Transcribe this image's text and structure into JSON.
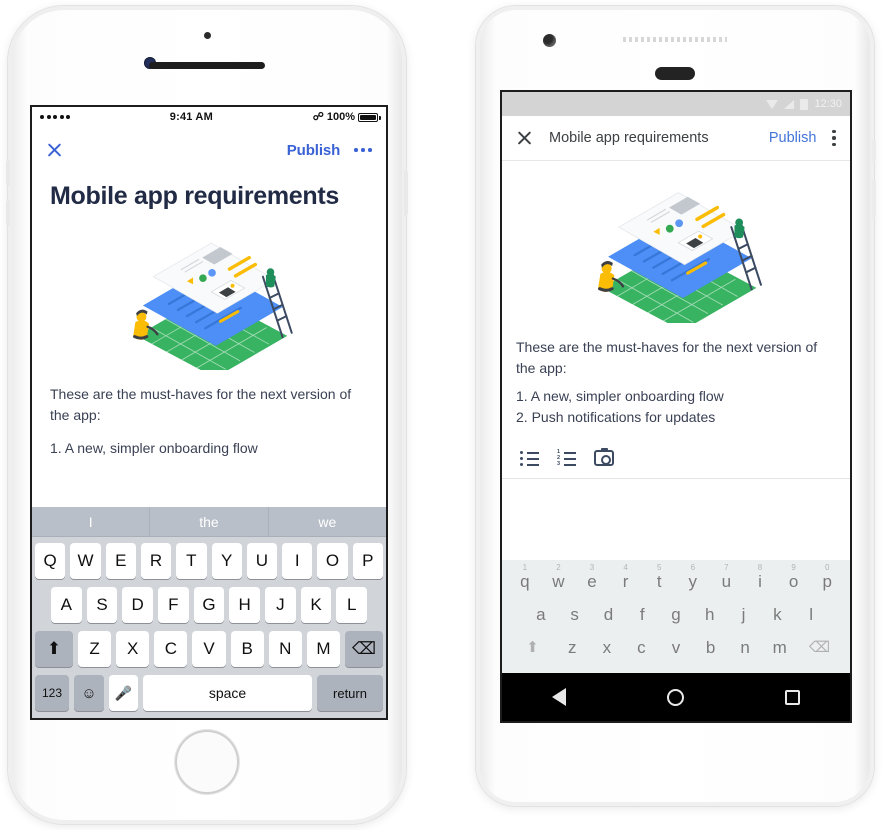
{
  "page": {
    "background": "#ffffff",
    "accent_blue": "#3B62D4",
    "android_blue": "#4275d8",
    "text_dark": "#222b45"
  },
  "ios_phone": {
    "device_name": "iphone-white",
    "status_bar": {
      "signal": "•••••",
      "time": "9:41 AM",
      "bluetooth_icon": "bluetooth-icon",
      "battery_percent": "100%",
      "battery_icon": "battery-full-icon"
    },
    "app_bar": {
      "close_icon": "close-icon",
      "publish_label": "Publish",
      "overflow_icon": "more-horizontal-icon"
    },
    "document": {
      "title": "Mobile app requirements",
      "illustration": "isometric-layers-illustration",
      "paragraph": "These are the must-haves for the next version of the app:",
      "list_items": [
        "1. A new, simpler onboarding flow"
      ]
    },
    "keyboard": {
      "predictions": [
        "I",
        "the",
        "we"
      ],
      "row1": [
        "Q",
        "W",
        "E",
        "R",
        "T",
        "Y",
        "U",
        "I",
        "O",
        "P"
      ],
      "row2": [
        "A",
        "S",
        "D",
        "F",
        "G",
        "H",
        "J",
        "K",
        "L"
      ],
      "row3": [
        "Z",
        "X",
        "C",
        "V",
        "B",
        "N",
        "M"
      ],
      "shift_icon": "shift-up-icon",
      "delete_icon": "backspace-icon",
      "numbers_label": "123",
      "emoji_icon": "emoji-smiley-icon",
      "mic_icon": "microphone-icon",
      "space_label": "space",
      "return_label": "return"
    }
  },
  "android_phone": {
    "device_name": "android-white",
    "status_bar": {
      "dropdown_icon": "triangle-down-icon",
      "signal_icon": "signal-bars-icon",
      "battery_icon": "battery-icon",
      "time": "12:30"
    },
    "app_bar": {
      "close_icon": "close-icon",
      "title": "Mobile app requirements",
      "publish_label": "Publish",
      "overflow_icon": "more-vertical-icon"
    },
    "document": {
      "illustration": "isometric-layers-illustration",
      "paragraph": "These are the must-haves for the next version of the app:",
      "list_items": [
        "1. A new, simpler onboarding flow",
        "2. Push notifications for updates"
      ]
    },
    "format_toolbar": {
      "bulleted_list_icon": "bulleted-list-icon",
      "numbered_list_icon": "numbered-list-icon",
      "camera_icon": "camera-icon"
    },
    "keyboard": {
      "row1": [
        "q",
        "w",
        "e",
        "r",
        "t",
        "y",
        "u",
        "i",
        "o",
        "p"
      ],
      "row1_numbers": [
        "1",
        "2",
        "3",
        "4",
        "5",
        "6",
        "7",
        "8",
        "9",
        "0"
      ],
      "row2": [
        "a",
        "s",
        "d",
        "f",
        "g",
        "h",
        "j",
        "k",
        "l"
      ],
      "row3": [
        "z",
        "x",
        "c",
        "v",
        "b",
        "n",
        "m"
      ],
      "shift_icon": "shift-up-icon",
      "delete_icon": "backspace-icon"
    },
    "nav_bar": {
      "back_icon": "nav-back-icon",
      "home_icon": "nav-home-icon",
      "recents_icon": "nav-recents-icon"
    }
  }
}
